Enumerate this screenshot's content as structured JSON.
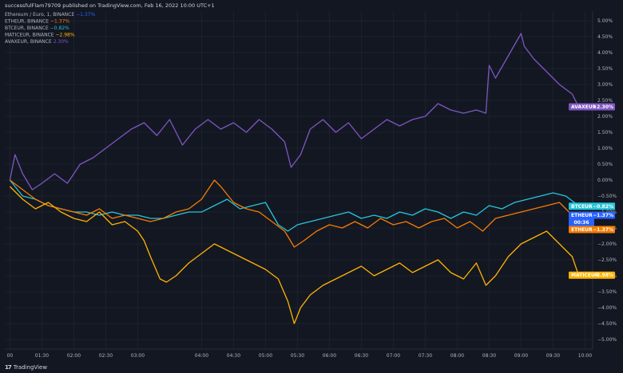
{
  "header": {
    "published": "successfulFlam79709 published on TradingView.com, Feb 16, 2022 10:00 UTC+1"
  },
  "legend": [
    {
      "name": "Ethereum / Euro, 1, BINANCE",
      "value": "−1.37%",
      "color": "#2962ff"
    },
    {
      "name": "ETHEUR, BINANCE",
      "value": "−1.37%",
      "color": "#f57c00"
    },
    {
      "name": "BTCEUR, BINANCE",
      "value": "−0.82%",
      "color": "#26c6da"
    },
    {
      "name": "MATICEUR, BINANCE",
      "value": "−2.98%",
      "color": "#ffb300"
    },
    {
      "name": "AVAXEUR, BINANCE",
      "value": "2.30%",
      "color": "#7e57c2"
    }
  ],
  "price_labels": [
    {
      "text": "AVAXEUR",
      "value": "+2.30%",
      "color": "#7e57c2",
      "y": 2.3
    },
    {
      "text": "BTCEUR",
      "value": "−0.82%",
      "color": "#26c6da",
      "y": -0.82
    },
    {
      "text": "ETHEUR",
      "value": "−1.37%",
      "color": "#2962ff",
      "y": -1.1,
      "extra": "00:36"
    },
    {
      "text": "ETHEUR",
      "value": "−1.37%",
      "color": "#f57c00",
      "y": -1.37
    },
    {
      "text": "MATICEUR",
      "value": "−2.98%",
      "color": "#ffb300",
      "y": -2.98
    }
  ],
  "footer": {
    "logo_text": "TradingView",
    "logo_mark": "17"
  },
  "chart_data": {
    "type": "line",
    "x_ticks": [
      "00",
      "01:30",
      "02:00",
      "02:30",
      "03:00",
      "04:00",
      "04:30",
      "05:00",
      "05:30",
      "06:00",
      "06:30",
      "07:00",
      "07:30",
      "08:00",
      "08:30",
      "09:00",
      "09:30",
      "10:00"
    ],
    "x_tick_hours": [
      1.0,
      1.5,
      2.0,
      2.5,
      3.0,
      4.0,
      4.5,
      5.0,
      5.5,
      6.0,
      6.5,
      7.0,
      7.5,
      8.0,
      8.5,
      9.0,
      9.5,
      10.0
    ],
    "y_ticks": [
      "5.00%",
      "4.50%",
      "4.00%",
      "3.50%",
      "3.00%",
      "2.50%",
      "2.00%",
      "1.50%",
      "1.00%",
      "0.50%",
      "0.00%",
      "−0.50%",
      "−1.00%",
      "−1.50%",
      "−2.00%",
      "−2.50%",
      "−3.00%",
      "−3.50%",
      "−4.00%",
      "−4.50%",
      "−5.00%"
    ],
    "y_tick_values": [
      5.0,
      4.5,
      4.0,
      3.5,
      3.0,
      2.5,
      2.0,
      1.5,
      1.0,
      0.5,
      0.0,
      -0.5,
      -1.0,
      -1.5,
      -2.0,
      -2.5,
      -3.0,
      -3.5,
      -4.0,
      -4.5,
      -5.0
    ],
    "ylim": [
      -5.3,
      5.3
    ],
    "series": [
      {
        "name": "AVAXEUR",
        "color": "#7e57c2",
        "x": [
          1.0,
          1.08,
          1.2,
          1.35,
          1.5,
          1.7,
          1.9,
          2.1,
          2.3,
          2.5,
          2.7,
          2.9,
          3.1,
          3.3,
          3.5,
          3.7,
          3.9,
          4.1,
          4.3,
          4.5,
          4.7,
          4.9,
          5.1,
          5.3,
          5.4,
          5.55,
          5.7,
          5.9,
          6.1,
          6.3,
          6.5,
          6.7,
          6.9,
          7.1,
          7.3,
          7.5,
          7.7,
          7.9,
          8.1,
          8.3,
          8.45,
          8.5,
          8.6,
          8.8,
          9.0,
          9.05,
          9.2,
          9.4,
          9.6,
          9.8,
          9.9
        ],
        "y": [
          0.0,
          0.8,
          0.2,
          -0.3,
          -0.1,
          0.2,
          -0.1,
          0.5,
          0.7,
          1.0,
          1.3,
          1.6,
          1.8,
          1.4,
          1.9,
          1.1,
          1.6,
          1.9,
          1.6,
          1.8,
          1.5,
          1.9,
          1.6,
          1.2,
          0.4,
          0.8,
          1.6,
          1.9,
          1.5,
          1.8,
          1.3,
          1.6,
          1.9,
          1.7,
          1.9,
          2.0,
          2.4,
          2.2,
          2.1,
          2.2,
          2.1,
          3.6,
          3.2,
          3.9,
          4.6,
          4.2,
          3.8,
          3.4,
          3.0,
          2.7,
          2.3
        ]
      },
      {
        "name": "BTCEUR",
        "color": "#26c6da",
        "x": [
          1.0,
          1.2,
          1.4,
          1.6,
          1.8,
          2.0,
          2.2,
          2.4,
          2.6,
          2.8,
          3.0,
          3.2,
          3.4,
          3.6,
          3.8,
          4.0,
          4.2,
          4.4,
          4.6,
          4.8,
          5.0,
          5.2,
          5.35,
          5.5,
          5.7,
          5.9,
          6.1,
          6.3,
          6.5,
          6.7,
          6.9,
          7.1,
          7.3,
          7.5,
          7.7,
          7.9,
          8.1,
          8.3,
          8.5,
          8.7,
          8.9,
          9.1,
          9.3,
          9.5,
          9.7,
          9.9
        ],
        "y": [
          0.0,
          -0.5,
          -0.6,
          -0.8,
          -0.9,
          -1.0,
          -1.0,
          -1.1,
          -1.0,
          -1.1,
          -1.1,
          -1.2,
          -1.2,
          -1.1,
          -1.0,
          -1.0,
          -0.8,
          -0.6,
          -0.9,
          -0.8,
          -0.7,
          -1.4,
          -1.6,
          -1.4,
          -1.3,
          -1.2,
          -1.1,
          -1.0,
          -1.2,
          -1.1,
          -1.2,
          -1.0,
          -1.1,
          -0.9,
          -1.0,
          -1.2,
          -1.0,
          -1.1,
          -0.8,
          -0.9,
          -0.7,
          -0.6,
          -0.5,
          -0.4,
          -0.5,
          -0.8
        ]
      },
      {
        "name": "ETHEUR",
        "color": "#f57c00",
        "x": [
          1.0,
          1.2,
          1.4,
          1.6,
          1.8,
          2.0,
          2.2,
          2.4,
          2.6,
          2.8,
          3.0,
          3.2,
          3.4,
          3.6,
          3.8,
          4.0,
          4.1,
          4.2,
          4.3,
          4.5,
          4.7,
          4.9,
          5.1,
          5.3,
          5.45,
          5.6,
          5.8,
          6.0,
          6.2,
          6.4,
          6.6,
          6.8,
          7.0,
          7.2,
          7.4,
          7.6,
          7.8,
          8.0,
          8.2,
          8.4,
          8.6,
          8.8,
          9.0,
          9.2,
          9.4,
          9.6,
          9.8,
          9.9
        ],
        "y": [
          0.0,
          -0.3,
          -0.6,
          -0.8,
          -0.9,
          -1.0,
          -1.1,
          -0.9,
          -1.2,
          -1.1,
          -1.2,
          -1.3,
          -1.2,
          -1.0,
          -0.9,
          -0.6,
          -0.3,
          0.0,
          -0.2,
          -0.7,
          -0.9,
          -1.0,
          -1.3,
          -1.6,
          -2.1,
          -1.9,
          -1.6,
          -1.4,
          -1.5,
          -1.3,
          -1.5,
          -1.2,
          -1.4,
          -1.3,
          -1.5,
          -1.3,
          -1.2,
          -1.5,
          -1.3,
          -1.6,
          -1.2,
          -1.1,
          -1.0,
          -0.9,
          -0.8,
          -0.7,
          -1.1,
          -1.37
        ]
      },
      {
        "name": "MATICEUR",
        "color": "#ffb300",
        "x": [
          1.0,
          1.2,
          1.4,
          1.6,
          1.8,
          2.0,
          2.2,
          2.4,
          2.6,
          2.8,
          3.0,
          3.1,
          3.2,
          3.35,
          3.45,
          3.6,
          3.8,
          4.0,
          4.2,
          4.4,
          4.6,
          4.8,
          5.0,
          5.2,
          5.35,
          5.45,
          5.55,
          5.7,
          5.9,
          6.1,
          6.3,
          6.5,
          6.7,
          6.9,
          7.1,
          7.3,
          7.5,
          7.7,
          7.9,
          8.1,
          8.3,
          8.45,
          8.6,
          8.8,
          9.0,
          9.2,
          9.4,
          9.6,
          9.8,
          9.9
        ],
        "y": [
          -0.2,
          -0.6,
          -0.9,
          -0.7,
          -1.0,
          -1.2,
          -1.3,
          -1.0,
          -1.4,
          -1.3,
          -1.6,
          -1.9,
          -2.4,
          -3.1,
          -3.2,
          -3.0,
          -2.6,
          -2.3,
          -2.0,
          -2.2,
          -2.4,
          -2.6,
          -2.8,
          -3.1,
          -3.8,
          -4.5,
          -4.0,
          -3.6,
          -3.3,
          -3.1,
          -2.9,
          -2.7,
          -3.0,
          -2.8,
          -2.6,
          -2.9,
          -2.7,
          -2.5,
          -2.9,
          -3.1,
          -2.6,
          -3.3,
          -3.0,
          -2.4,
          -2.0,
          -1.8,
          -1.6,
          -2.0,
          -2.4,
          -2.98
        ]
      }
    ]
  }
}
